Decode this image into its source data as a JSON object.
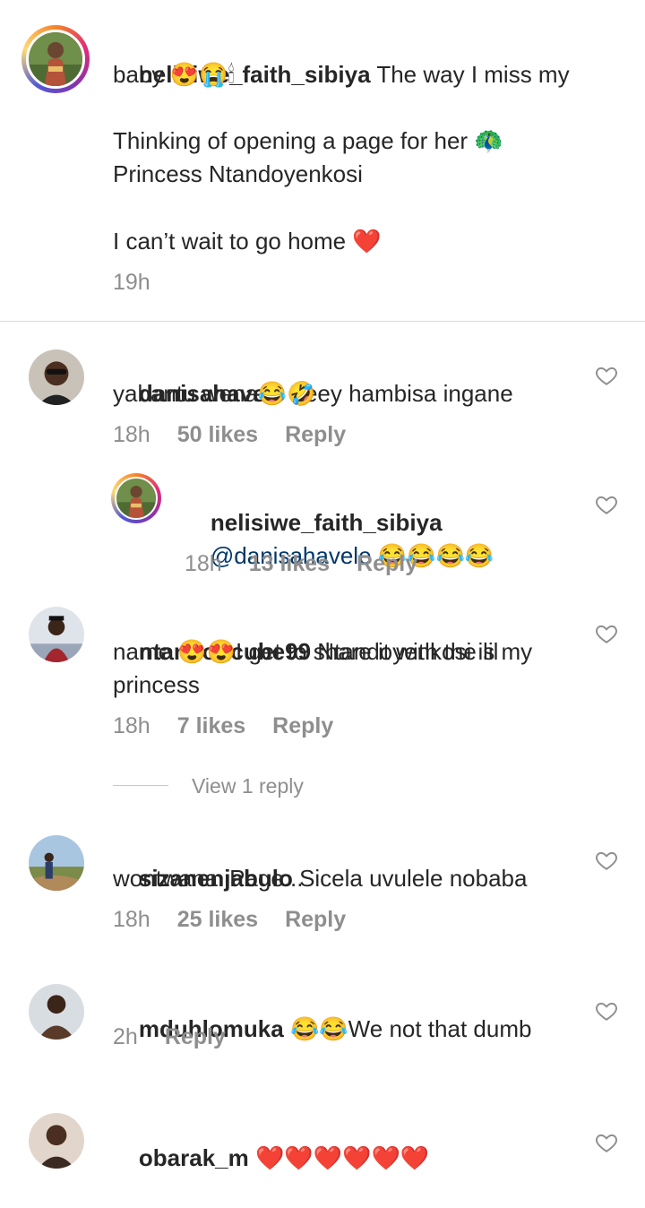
{
  "caption": {
    "username": "nelisiwe_faith_sibiya",
    "line1": "The way I miss my",
    "line2": "baby 😍😭🕯",
    "line3": "Thinking of opening a page for her 🦚",
    "line4": "Princess Ntandoyenkosi",
    "line5": "I can’t wait to go home ❤️",
    "time": "19h"
  },
  "comments": [
    {
      "username": "danisahavele",
      "text_a": "Yeey hambisa ingane",
      "text_b": "yabantu wena😂🤣",
      "time": "18h",
      "likes": "50 likes",
      "reply": "Reply"
    },
    {
      "username": "nelisiwe_faith_sibiya",
      "mention": "@danisahavele",
      "text_b": " 😂😂😂😂",
      "time": "18h",
      "likes": "13 likes",
      "reply": "Reply"
    },
    {
      "username": "ntandoncube99",
      "text_a": "Ntandoyenkosi is my",
      "text_b": "name 😍😍I get to share it with the lil",
      "text_c": "princess",
      "time": "18h",
      "likes": "7 likes",
      "reply": "Reply",
      "view_replies": "View 1 reply"
    },
    {
      "username": "sizanenjabulo",
      "text_a": "Sicela uvulele nobaba",
      "text_b": "wontwana iPage...",
      "time": "18h",
      "likes": "25 likes",
      "reply": "Reply"
    },
    {
      "username": "mduhlomuka",
      "text_a": "😂😂We not that dumb",
      "time": "2h",
      "reply": "Reply"
    },
    {
      "username": "obarak_m",
      "text_a": "❤️❤️❤️❤️❤️❤️"
    }
  ],
  "colors": {
    "text": "#262626",
    "secondary": "#8e8e8e",
    "mention": "#00376b",
    "divider": "#dbdbdb"
  }
}
